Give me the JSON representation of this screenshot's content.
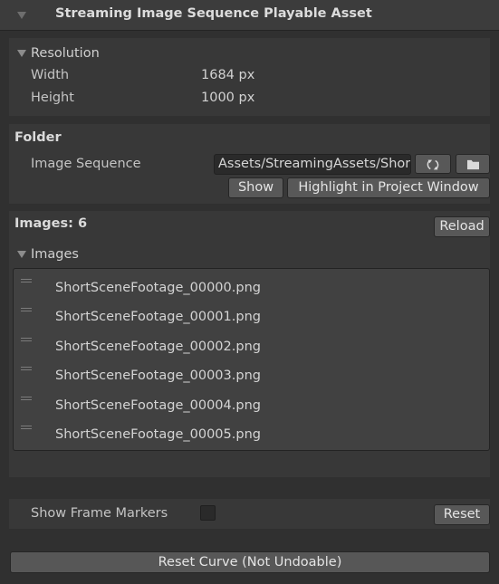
{
  "header": {
    "title": "Streaming Image Sequence Playable Asset",
    "fold_icon": "triangle-down-icon"
  },
  "resolution": {
    "label": "Resolution",
    "width_label": "Width",
    "width_value": "1684 px",
    "height_label": "Height",
    "height_value": "1000 px"
  },
  "folder": {
    "title": "Folder",
    "image_sequence_label": "Image Sequence",
    "image_sequence_value": "Assets/StreamingAssets/ShortSceneFootage",
    "refresh_icon": "refresh-icon",
    "folder_icon": "folder-icon",
    "show_label": "Show",
    "highlight_label": "Highlight in Project Window"
  },
  "images": {
    "count_label": "Images: 6",
    "reload_label": "Reload",
    "foldout_label": "Images",
    "items": [
      "ShortSceneFootage_00000.png",
      "ShortSceneFootage_00001.png",
      "ShortSceneFootage_00002.png",
      "ShortSceneFootage_00003.png",
      "ShortSceneFootage_00004.png",
      "ShortSceneFootage_00005.png"
    ]
  },
  "frame_markers": {
    "label": "Show Frame Markers",
    "checked": false,
    "reset_label": "Reset"
  },
  "reset_curve_label": "Reset Curve (Not Undoable)"
}
